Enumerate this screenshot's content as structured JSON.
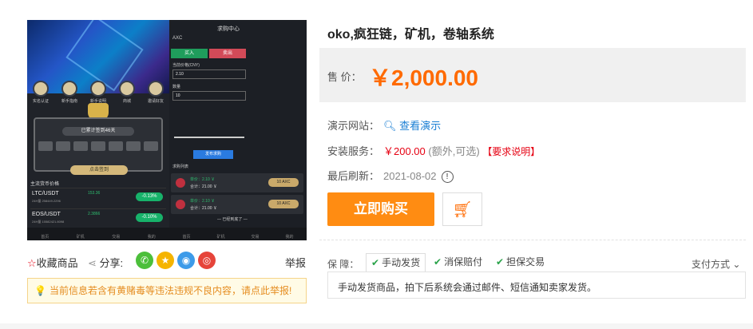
{
  "product": {
    "title": "oko,疯狂链，矿机，卷轴系统",
    "price_label": "售  价：",
    "price": "￥2,000.00",
    "demo_label": "演示网站：",
    "demo_link": "查看演示",
    "install_label": "安装服务：",
    "install_price": "￥200.00",
    "install_note": "(额外,可选)",
    "install_req": "【要求说明】",
    "refresh_label": "最后刷新：",
    "refresh_date": "2021-08-02",
    "buy_label": "立即购买",
    "guarantee_label": "保  障：",
    "guarantees": [
      "手动发货",
      "消保赔付",
      "担保交易"
    ],
    "pay_label": "支付方式",
    "shipping_note": "手动发货商品，拍下后系统会通过邮件、短信通知卖家发货。"
  },
  "actions": {
    "favorite": "收藏商品",
    "share": "分享:",
    "report": "举报",
    "warning": "当前信息若含有黄赌毒等违法违规不良内容，请点此举报!"
  },
  "preview": {
    "left": {
      "icons": [
        "实名认证",
        "新手指南",
        "新手说明",
        "商城",
        "邀请好友"
      ],
      "sign_days": "已累计签到46天",
      "sign_btn": "点击签到",
      "market_title": "主流货币价格",
      "rows": [
        {
          "name": "LTC/USDT",
          "sub": "24H量 258449.2296",
          "price": "153.36",
          "change": "-0.13%"
        },
        {
          "name": "EOS/USDT",
          "sub": "24H量 15582421.8098",
          "price": "2.3866",
          "change": "-0.10%"
        }
      ],
      "tabs": [
        "首页",
        "矿机",
        "交易",
        "我的"
      ]
    },
    "right": {
      "title": "求购中心",
      "symbol": "AXC",
      "buy": "买入",
      "sell": "卖出",
      "price_label": "当前价格(CNY)",
      "price_value": "2.10",
      "qty_label": "数量",
      "qty_value": "10",
      "publish": "发布求购",
      "list_title": "求购列表",
      "orders": [
        {
          "unit": "单价：2.10 ￥",
          "total": "合计：21.00 ￥",
          "btn": "10 AXC"
        },
        {
          "unit": "单价：2.10 ￥",
          "total": "合计：21.00 ￥",
          "btn": "10 AXC"
        }
      ],
      "end": "— 已经到底了 —",
      "tabs": [
        "首页",
        "矿机",
        "交易",
        "我的"
      ]
    }
  }
}
